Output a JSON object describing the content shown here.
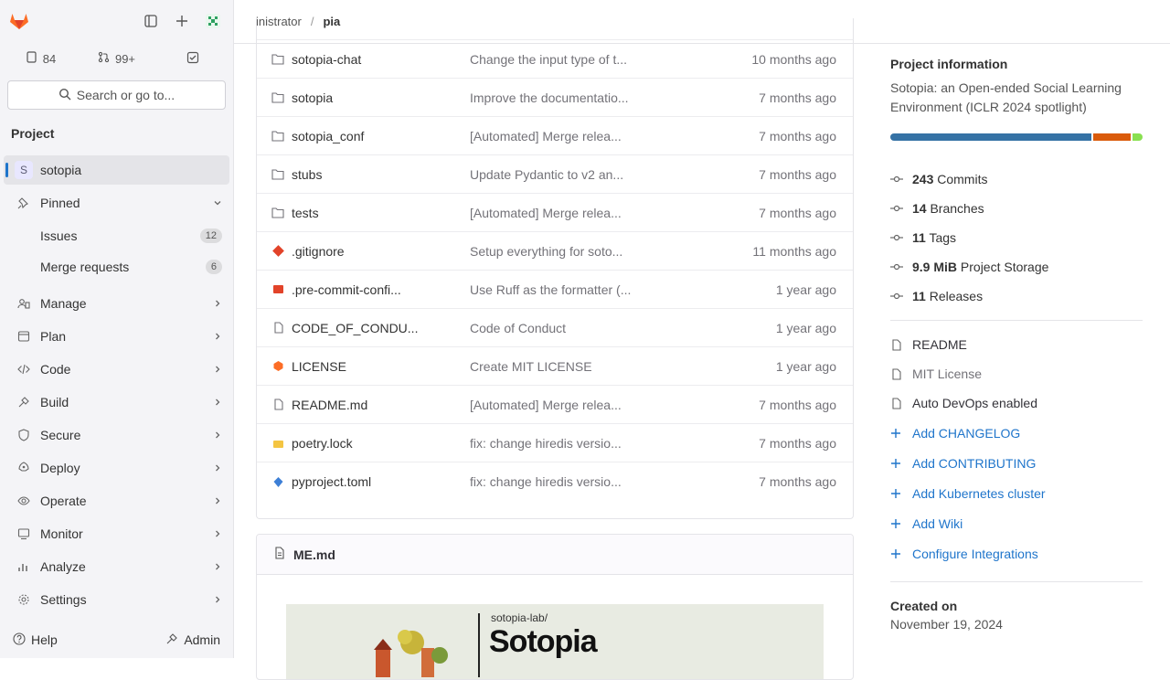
{
  "sidebar": {
    "counts": [
      {
        "value": "84"
      },
      {
        "value": "99+"
      },
      {
        "value": ""
      }
    ],
    "search_label": "Search or go to...",
    "section_label": "Project",
    "project_item": {
      "avatar": "S",
      "label": "sotopia"
    },
    "pinned_label": "Pinned",
    "pinned_items": [
      {
        "label": "Issues",
        "count": "12"
      },
      {
        "label": "Merge requests",
        "count": "6"
      }
    ],
    "nav": [
      {
        "label": "Manage",
        "icon": "manage-icon"
      },
      {
        "label": "Plan",
        "icon": "plan-icon"
      },
      {
        "label": "Code",
        "icon": "code-icon"
      },
      {
        "label": "Build",
        "icon": "build-icon"
      },
      {
        "label": "Secure",
        "icon": "shield-icon"
      },
      {
        "label": "Deploy",
        "icon": "deploy-icon"
      },
      {
        "label": "Operate",
        "icon": "operate-icon"
      },
      {
        "label": "Monitor",
        "icon": "monitor-icon"
      },
      {
        "label": "Analyze",
        "icon": "analyze-icon"
      },
      {
        "label": "Settings",
        "icon": "gear-icon"
      }
    ],
    "help_label": "Help",
    "admin_label": "Admin"
  },
  "breadcrumb": {
    "parent": "Administrator",
    "parent_visible": "inistrator",
    "current": "sotopia",
    "current_visible": "pia"
  },
  "files": [
    {
      "name": "sotopia-chat",
      "message": "Change the input type of t...",
      "date": "10 months ago",
      "type": "folder"
    },
    {
      "name": "sotopia",
      "message": "Improve the documentatio...",
      "date": "7 months ago",
      "type": "folder"
    },
    {
      "name": "sotopia_conf",
      "message": "[Automated] Merge relea...",
      "date": "7 months ago",
      "type": "folder"
    },
    {
      "name": "stubs",
      "message": "Update Pydantic to v2 an...",
      "date": "7 months ago",
      "type": "folder"
    },
    {
      "name": "tests",
      "message": "[Automated] Merge relea...",
      "date": "7 months ago",
      "type": "folder"
    },
    {
      "name": ".gitignore",
      "message": "Setup everything for soto...",
      "date": "11 months ago",
      "type": "git"
    },
    {
      "name": ".pre-commit-confi...",
      "message": "Use Ruff as the formatter (...",
      "date": "1 year ago",
      "type": "yaml"
    },
    {
      "name": "CODE_OF_CONDU...",
      "message": "Code of Conduct",
      "date": "1 year ago",
      "type": "file"
    },
    {
      "name": "LICENSE",
      "message": "Create MIT LICENSE",
      "date": "1 year ago",
      "type": "license"
    },
    {
      "name": "README.md",
      "message": "[Automated] Merge relea...",
      "date": "7 months ago",
      "type": "markdown"
    },
    {
      "name": "poetry.lock",
      "message": "fix: change hiredis versio...",
      "date": "7 months ago",
      "type": "lock"
    },
    {
      "name": "pyproject.toml",
      "message": "fix: change hiredis versio...",
      "date": "7 months ago",
      "type": "toml"
    }
  ],
  "readme": {
    "title": "README.md",
    "title_visible": "ME.md",
    "banner_org": "sotopia-lab/",
    "banner_title": "Sotopia"
  },
  "project_info": {
    "heading": "Project information",
    "description": "Sotopia: an Open-ended Social Learning Environment (ICLR 2024 spotlight)",
    "languages": [
      {
        "share": 0.81,
        "color": "#3572a5"
      },
      {
        "share": 0.15,
        "color": "#da5b0b"
      },
      {
        "share": 0.04,
        "color": "#89e051"
      }
    ],
    "stats": [
      {
        "count": "243",
        "label": "Commits",
        "icon": "commit-icon"
      },
      {
        "count": "14",
        "label": "Branches",
        "icon": "branch-icon"
      },
      {
        "count": "11",
        "label": "Tags",
        "icon": "tag-icon"
      },
      {
        "count": "9.9 MiB",
        "label": "Project Storage",
        "icon": "storage-icon"
      },
      {
        "count": "11",
        "label": "Releases",
        "icon": "rocket-icon"
      }
    ],
    "links": [
      {
        "label": "README",
        "icon": "document-icon",
        "style": "plain"
      },
      {
        "label": "MIT License",
        "icon": "scale-icon",
        "style": "muted"
      },
      {
        "label": "Auto DevOps enabled",
        "icon": "settings-icon",
        "style": "plain"
      },
      {
        "label": "Add CHANGELOG",
        "icon": "plus-icon",
        "style": "link"
      },
      {
        "label": "Add CONTRIBUTING",
        "icon": "plus-icon",
        "style": "link"
      },
      {
        "label": "Add Kubernetes cluster",
        "icon": "plus-icon",
        "style": "link"
      },
      {
        "label": "Add Wiki",
        "icon": "plus-icon",
        "style": "link"
      },
      {
        "label": "Configure Integrations",
        "icon": "plus-icon",
        "style": "link"
      }
    ],
    "created_label": "Created on",
    "created_value": "November 19, 2024"
  },
  "colors": {
    "accent": "#1f75cb",
    "fox": "#fc6d26"
  }
}
